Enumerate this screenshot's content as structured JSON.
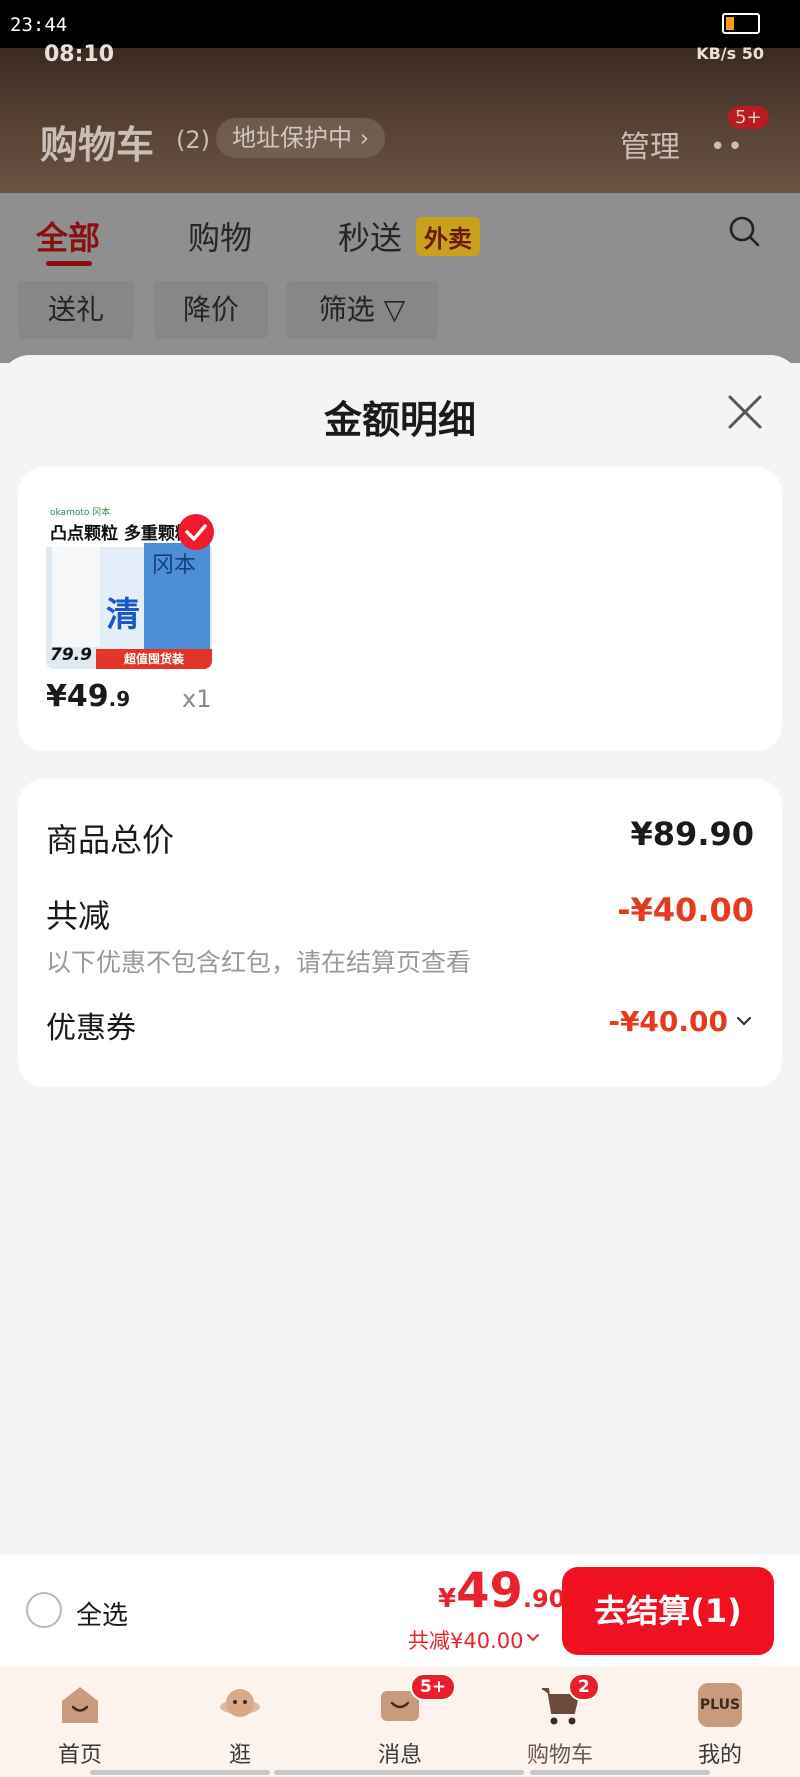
{
  "os": {
    "time": "23:44"
  },
  "app": {
    "inner_time": "08:10",
    "inner_status_right": "KB/s  50",
    "title": "购物车",
    "count": "(2)",
    "address_pill": "地址保护中",
    "manage": "管理",
    "more_badge": "5+"
  },
  "tabs": {
    "all": "全部",
    "shopping": "购物",
    "fast": "秒送",
    "waimai": "外卖"
  },
  "chips": [
    "送礼",
    "降价",
    "筛选"
  ],
  "sheet": {
    "title": "金额明细",
    "product": {
      "brand": "okamoto 冈本",
      "headline": "凸点颗粒 多重颗粒",
      "box_char": "清",
      "box_side": "冈本",
      "img_price": "79.9",
      "img_band": "超值囤货装",
      "price_int": "¥49",
      "price_dec": ".9",
      "qty": "x1"
    },
    "summary": {
      "total_label": "商品总价",
      "total_value": "¥89.90",
      "reduce_label": "共减",
      "reduce_value": "-¥40.00",
      "note": "以下优惠不包含红包，请在结算页查看",
      "coupon_label": "优惠券",
      "coupon_value": "-¥40.00"
    }
  },
  "checkout": {
    "select_all": "全选",
    "yen": "¥",
    "price_int": "49",
    "price_dec": ".90",
    "reduce_note": "共减¥40.00",
    "button": "去结算(1)"
  },
  "nav": {
    "home": "首页",
    "stroll": "逛",
    "messages": "消息",
    "messages_badge": "5+",
    "cart": "购物车",
    "cart_badge": "2",
    "mine": "我的",
    "plus": "PLUS"
  }
}
